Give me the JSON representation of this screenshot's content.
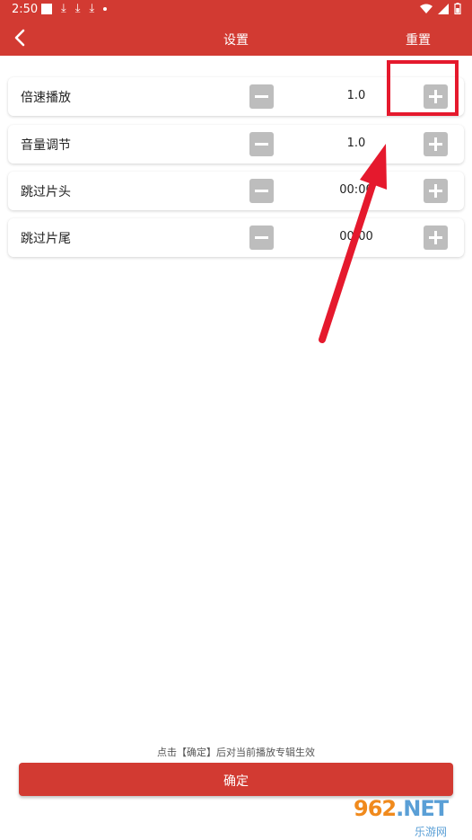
{
  "status_bar": {
    "time": "2:50",
    "download_arrows": [
      "⤓",
      "⤓",
      "⤓"
    ]
  },
  "appbar": {
    "title": "设置",
    "reset_label": "重置",
    "back_icon": "chevron-left-icon"
  },
  "settings": [
    {
      "label": "倍速播放",
      "value": "1.0"
    },
    {
      "label": "音量调节",
      "value": "1.0"
    },
    {
      "label": "跳过片头",
      "value": "00:00"
    },
    {
      "label": "跳过片尾",
      "value": "00:00"
    }
  ],
  "footer": {
    "hint": "点击【确定】后对当前播放专辑生效",
    "confirm_label": "确定"
  },
  "watermark": {
    "logo_digits": "962",
    "logo_suffix": ".NET",
    "subtitle": "乐游网"
  },
  "colors": {
    "accent": "#d23a32",
    "button_gray": "#bdbdbd",
    "annotation": "#e5192d"
  }
}
